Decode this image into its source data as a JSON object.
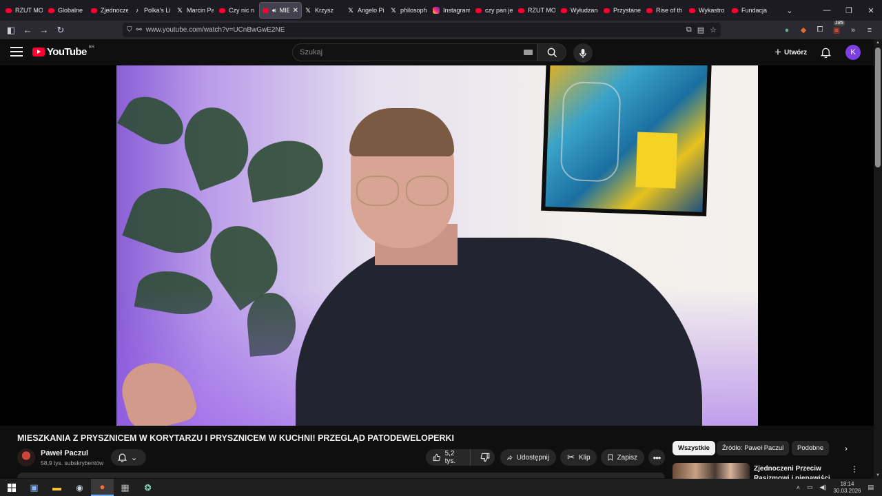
{
  "browser": {
    "tabs": [
      {
        "label": "RZUT MOCY",
        "icon": "youtube-icon"
      },
      {
        "label": "Globalne",
        "icon": "youtube-icon"
      },
      {
        "label": "Zjednoczeni",
        "icon": "youtube-icon"
      },
      {
        "label": "Polka's Li",
        "icon": "tiktok-icon"
      },
      {
        "label": "Marcin Pa",
        "icon": "x-icon"
      },
      {
        "label": "Czy nic n",
        "icon": "youtube-icon"
      },
      {
        "label": "MIE",
        "icon": "youtube-icon",
        "active": true
      },
      {
        "label": "Krzysz",
        "icon": "x-icon"
      },
      {
        "label": "Angelo Pi",
        "icon": "x-icon"
      },
      {
        "label": "philosoph",
        "icon": "x-icon"
      },
      {
        "label": "Instagram",
        "icon": "instagram-icon"
      },
      {
        "label": "czy pan je",
        "icon": "youtube-icon"
      },
      {
        "label": "RZUT MO",
        "icon": "youtube-icon"
      },
      {
        "label": "Wyłudzan",
        "icon": "youtube-icon"
      },
      {
        "label": "Przystane",
        "icon": "youtube-icon"
      },
      {
        "label": "Rise of th",
        "icon": "youtube-icon"
      },
      {
        "label": "Wykastro",
        "icon": "youtube-icon"
      },
      {
        "label": "Fundacja",
        "icon": "youtube-icon"
      }
    ],
    "url": "www.youtube.com/watch?v=UCnBwGwE2NE",
    "extension_badge": "185"
  },
  "youtube": {
    "logo_text": "YouTube",
    "country_code": "BR",
    "search_placeholder": "Szukaj",
    "create_label": "Utwórz",
    "account_initial": "K",
    "accent": "#ff0033"
  },
  "video": {
    "title": "MIESZKANIA Z PRYSZNICEM W KORYTARZU I PRYSZNICEM W KUCHNI! PRZEGLĄD PATODEWELOPERKI",
    "channel_name": "Paweł Paczul",
    "subscribers": "58,9 tys. subskrybentów",
    "likes": "5,2 tys.",
    "share_label": "Udostępnij",
    "clip_label": "Klip",
    "save_label": "Zapisz"
  },
  "sidebar": {
    "chips": [
      "Wszystkie",
      "Źródło: Paweł Paczul",
      "Podobne"
    ],
    "recommendation_title": "Zjednoczeni Przeciw Rasizmowi i nienawiści"
  },
  "taskbar": {
    "time": "18:14",
    "date": "30.03.2026"
  }
}
